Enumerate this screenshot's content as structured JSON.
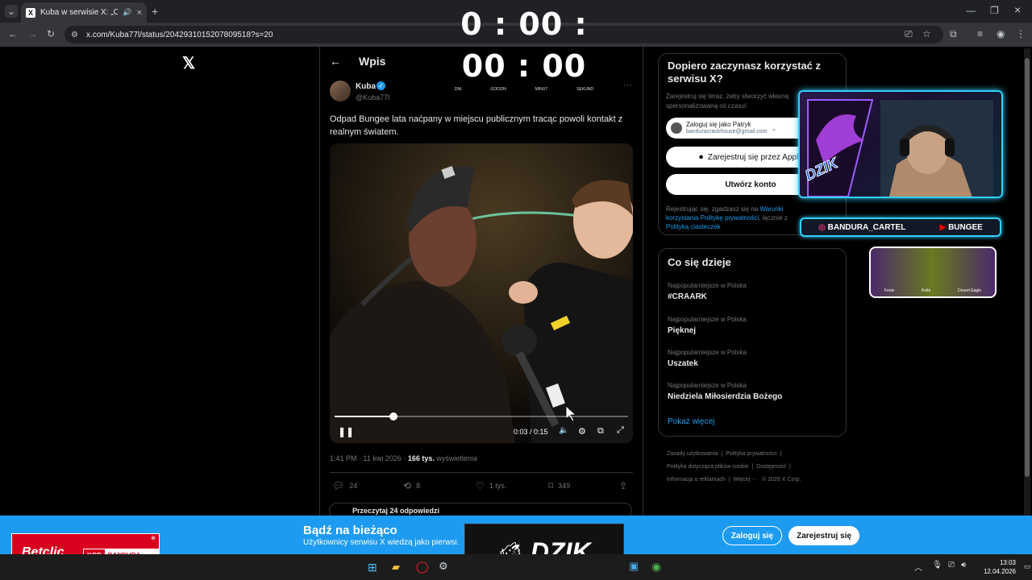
{
  "browser": {
    "tab_title": "Kuba w serwisie X: „Odpad",
    "url": "x.com/Kuba77l/status/2042931015207809518?s=20"
  },
  "timer": {
    "display": "0 : 00 : 00 : 00",
    "labels": [
      "DNI",
      "GODZIN",
      "MINUT",
      "SEKUND"
    ]
  },
  "header": {
    "title": "Wpis"
  },
  "tweet": {
    "author_name": "Kuba",
    "author_handle": "@Kuba77l",
    "text": "Odpad Bungee lata naćpany w miejscu publicznym tracąc powoli kontakt z realnym światem.",
    "video_time": "0:03 / 0:15",
    "video_progress": 0.2,
    "meta_time": "1:41 PM · 11 kwi 2026 · ",
    "meta_views": "166 tys.",
    "meta_views_label": " wyświetlenia",
    "replies": "24",
    "reposts": "8",
    "likes": "1 tys.",
    "bookmarks": "349",
    "read_replies": "Przeczytaj 24 odpowiedzi"
  },
  "signup": {
    "title": "Dopiero zaczynasz korzystać z serwisu X?",
    "subtitle": "Zarejestruj się teraz, żeby stworzyć własną spersonalizowaną oś czasu!",
    "google_label": "Zaloguj się jako Patryk",
    "google_email": "banduracrackhouse@gmail.com",
    "apple_label": "Zarejestruj się przez Apple",
    "create_label": "Utwórz konto",
    "terms_pre": "Rejestrując się, zgadzasz się na ",
    "terms_link": "Warunki korzystania",
    "privacy_link": "Politykę prywatności",
    "terms_mid": ", łącznie z ",
    "cookies_link": "Polityką ciasteczek"
  },
  "trends": {
    "title": "Co się dzieje",
    "items": [
      {
        "category": "Najpopularniejsze w Polska",
        "name": "#CRAARK"
      },
      {
        "category": "Najpopularniejsze w Polska",
        "name": "Pięknej"
      },
      {
        "category": "Najpopularniejsze w Polska",
        "name": "Uszatek"
      },
      {
        "category": "Najpopularniejsze w Polska",
        "name": "Niedziela Miłosierdzia Bożego"
      }
    ],
    "show_more": "Pokaż więcej"
  },
  "footer": {
    "links": [
      "Zasady użytkowania",
      "Polityka prywatności",
      "Polityka dotycząca plików cookie",
      "Dostępność",
      "Informacja o reklamach",
      "Więcej ···",
      "© 2026 X Corp."
    ]
  },
  "stream": {
    "instagram": "BANDURA_CARTEL",
    "youtube": "BUNGEE",
    "logo_text": "DZIK",
    "skins": [
      "Fenix",
      "Knife",
      "Desert Eagle"
    ]
  },
  "banner": {
    "title": "Bądź na bieżąco",
    "subtitle": "Użytkownicy serwisu X wiedzą jako pierwsi.",
    "login": "Zaloguj się",
    "signup": "Zarejestruj się",
    "dzik": "DZIK",
    "betclic": "Betclic",
    "kod": "KOD",
    "bandura": "BANDURA"
  },
  "taskbar": {
    "time": "13:03",
    "date": "12.04.2026"
  },
  "colors": {
    "accent_blue": "#1d9bf0",
    "cyan_glow": "#31d0ff",
    "betclic_red": "#d8001e"
  }
}
